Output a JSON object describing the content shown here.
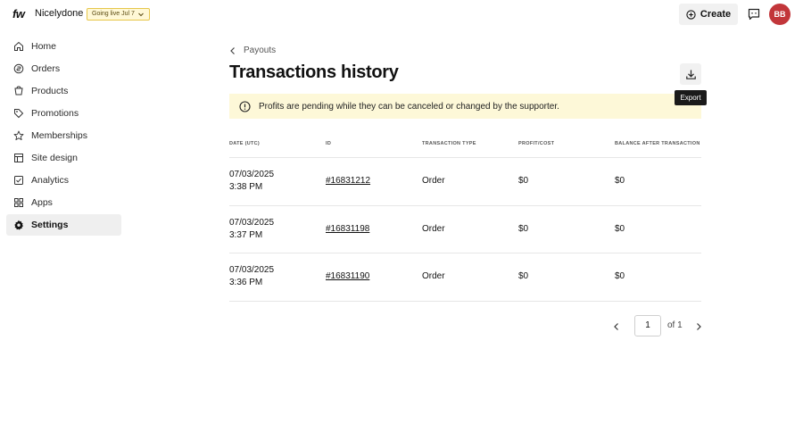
{
  "header": {
    "logo": "fw",
    "store_name": "Nicelydone",
    "go_live_label": "Going live Jul 7",
    "create_label": "Create",
    "avatar_initials": "BB"
  },
  "sidebar": {
    "items": [
      {
        "label": "Home",
        "icon": "home-icon"
      },
      {
        "label": "Orders",
        "icon": "orders-icon"
      },
      {
        "label": "Products",
        "icon": "products-icon"
      },
      {
        "label": "Promotions",
        "icon": "tag-icon"
      },
      {
        "label": "Memberships",
        "icon": "star-icon"
      },
      {
        "label": "Site design",
        "icon": "layout-icon"
      },
      {
        "label": "Analytics",
        "icon": "analytics-icon"
      },
      {
        "label": "Apps",
        "icon": "apps-icon"
      },
      {
        "label": "Settings",
        "icon": "gear-icon",
        "active": true
      }
    ]
  },
  "main": {
    "breadcrumb": "Payouts",
    "title": "Transactions history",
    "export_tooltip": "Export",
    "banner_text": "Profits are pending while they can be canceled or changed by the supporter."
  },
  "table": {
    "headers": [
      "DATE (UTC)",
      "ID",
      "TRANSACTION TYPE",
      "PROFIT/COST",
      "BALANCE AFTER TRANSACTION"
    ],
    "rows": [
      {
        "date": "07/03/2025",
        "time": "3:38 PM",
        "id": "#16831212",
        "type": "Order",
        "profit": "$0",
        "balance": "$0"
      },
      {
        "date": "07/03/2025",
        "time": "3:37 PM",
        "id": "#16831198",
        "type": "Order",
        "profit": "$0",
        "balance": "$0"
      },
      {
        "date": "07/03/2025",
        "time": "3:36 PM",
        "id": "#16831190",
        "type": "Order",
        "profit": "$0",
        "balance": "$0"
      }
    ]
  },
  "pagination": {
    "current_page": "1",
    "of_label": "of 1"
  },
  "colors": {
    "banner_bg": "#fdf8d8",
    "avatar_bg": "#c2363a",
    "go_live_bg": "#fff8d6"
  }
}
